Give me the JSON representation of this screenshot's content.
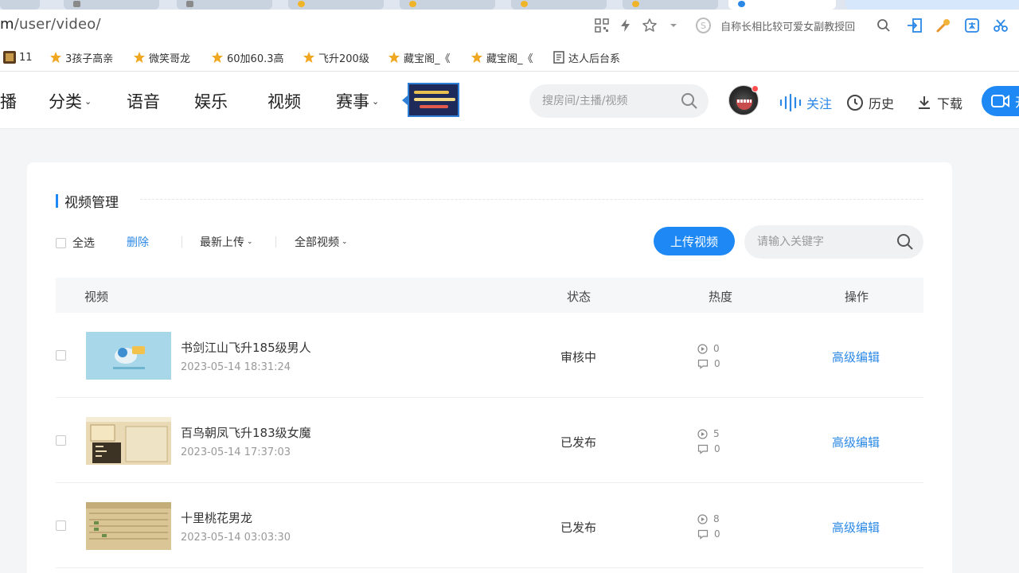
{
  "browser": {
    "url_prefix": "m",
    "url_path": "/user/video/",
    "search_engine_text": "自称长相比较可爱女副教授回"
  },
  "bookmarks": [
    {
      "label": "11",
      "icon": "game-icon"
    },
    {
      "label": "3孩子高亲",
      "icon": "star-bookmark-icon"
    },
    {
      "label": "微笑哥龙",
      "icon": "star-bookmark-icon"
    },
    {
      "label": "60加60.3高",
      "icon": "star-bookmark-icon"
    },
    {
      "label": "飞升200级",
      "icon": "star-bookmark-icon"
    },
    {
      "label": "藏宝阁_《",
      "icon": "star-bookmark-icon"
    },
    {
      "label": "藏宝阁_《",
      "icon": "star-bookmark-icon"
    },
    {
      "label": "达人后台系",
      "icon": "document-icon"
    }
  ],
  "nav": {
    "items": [
      {
        "label": "播"
      },
      {
        "label": "分类",
        "caret": "⌄"
      },
      {
        "label": "语音"
      },
      {
        "label": "娱乐"
      },
      {
        "label": "视频"
      },
      {
        "label": "赛事",
        "caret": "⌄"
      }
    ],
    "search_placeholder": "搜房间/主播/视频",
    "follow_label": "关注",
    "history_label": "历史",
    "download_label": "下载",
    "open_label": "开"
  },
  "panel": {
    "title": "视频管理",
    "select_all": "全选",
    "delete": "删除",
    "sort_label": "最新上传",
    "filter_label": "全部视频",
    "caret": "⌄",
    "upload_label": "上传视频",
    "search_placeholder": "请输入关键字",
    "columns": {
      "video": "视频",
      "status": "状态",
      "heat": "热度",
      "action": "操作"
    },
    "rows": [
      {
        "title": "书剑江山飞升185级男人",
        "date": "2023-05-14 18:31:24",
        "status": "审核中",
        "plays": "0",
        "comments": "0",
        "action": "高级编辑"
      },
      {
        "title": "百鸟朝凤飞升183级女魔",
        "date": "2023-05-14 17:37:03",
        "status": "已发布",
        "plays": "5",
        "comments": "0",
        "action": "高级编辑"
      },
      {
        "title": "十里桃花男龙",
        "date": "2023-05-14 03:03:30",
        "status": "已发布",
        "plays": "8",
        "comments": "0",
        "action": "高级编辑"
      }
    ]
  },
  "colors": {
    "accent": "#1e88f5",
    "link": "#2b88e6",
    "page_bg": "#f4f5f7"
  }
}
